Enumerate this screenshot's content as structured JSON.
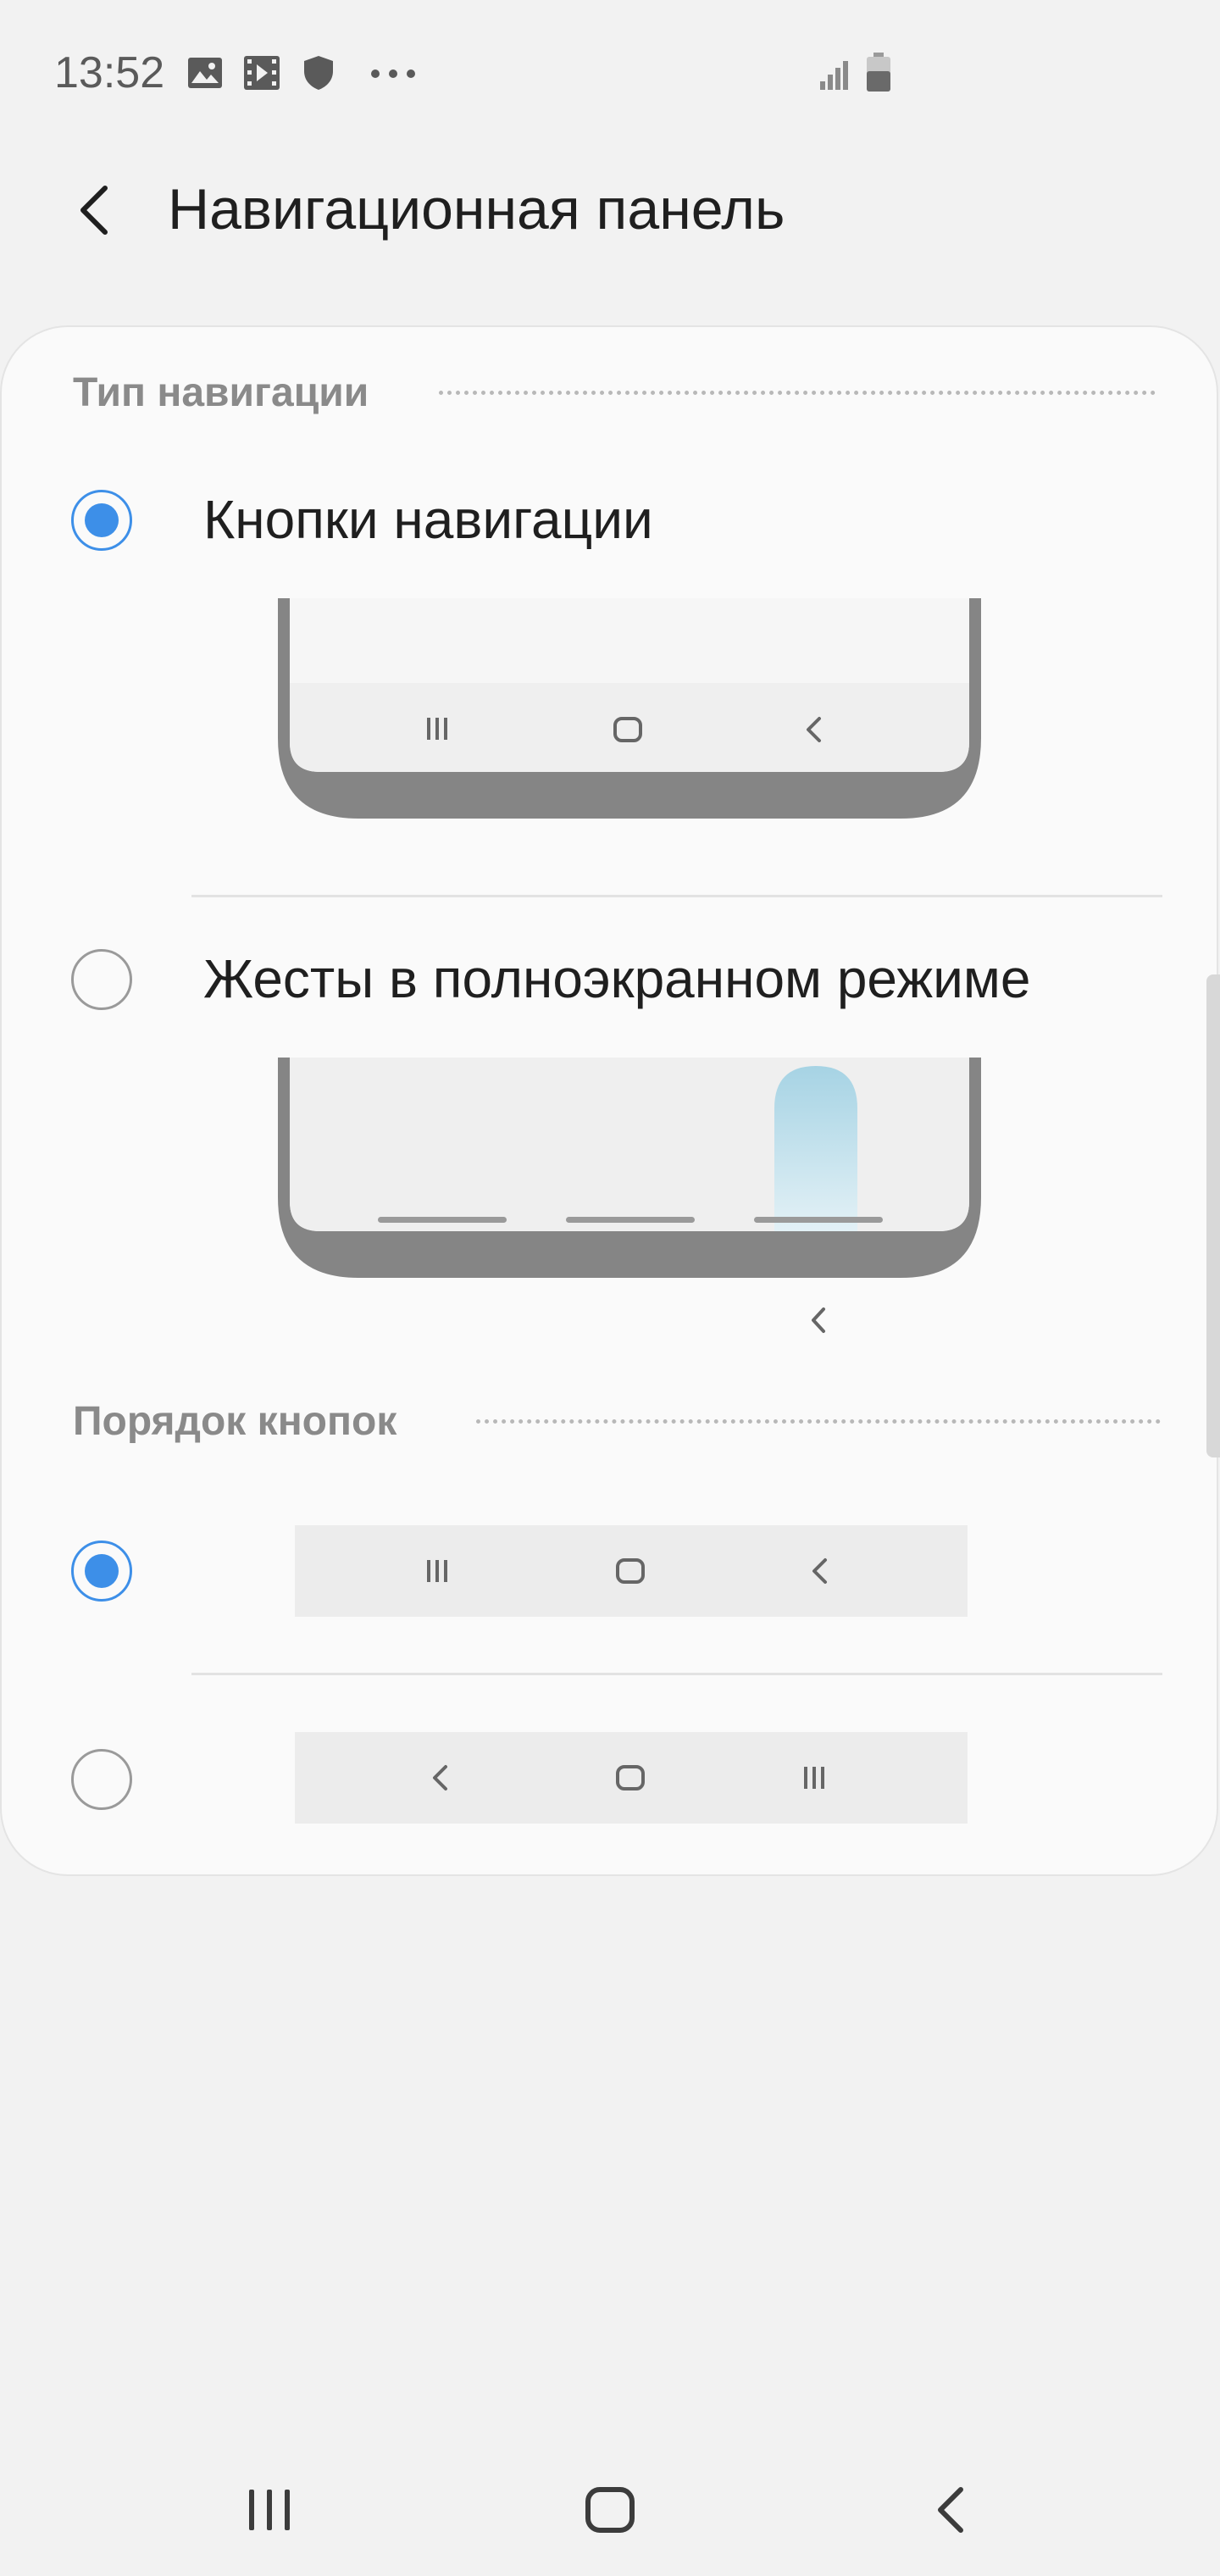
{
  "status_bar": {
    "time": "13:52",
    "left_icons": [
      "gallery-icon",
      "video-icon",
      "shield-icon",
      "more-dots-icon"
    ],
    "right_icons": [
      "signal-icon",
      "battery-icon"
    ]
  },
  "header": {
    "back_icon": "chevron-left-icon",
    "title": "Навигационная панель"
  },
  "navigation_type": {
    "header": "Тип навигации",
    "options": [
      {
        "label": "Кнопки навигации",
        "selected": true
      },
      {
        "label": "Жесты в полноэкранном режиме",
        "selected": false
      }
    ]
  },
  "button_order": {
    "header": "Порядок кнопок",
    "options": [
      {
        "selected": true,
        "buttons": [
          "recents-icon",
          "home-icon",
          "back-icon"
        ]
      },
      {
        "selected": false,
        "buttons": [
          "back-icon",
          "home-icon",
          "recents-icon"
        ]
      }
    ]
  },
  "system_nav": {
    "buttons": [
      "recents-icon",
      "home-icon",
      "back-icon"
    ]
  },
  "colors": {
    "accent": "#3d8fe8",
    "background": "#f2f2f2",
    "card": "#fafafa",
    "section_header": "#8a8a8a"
  }
}
